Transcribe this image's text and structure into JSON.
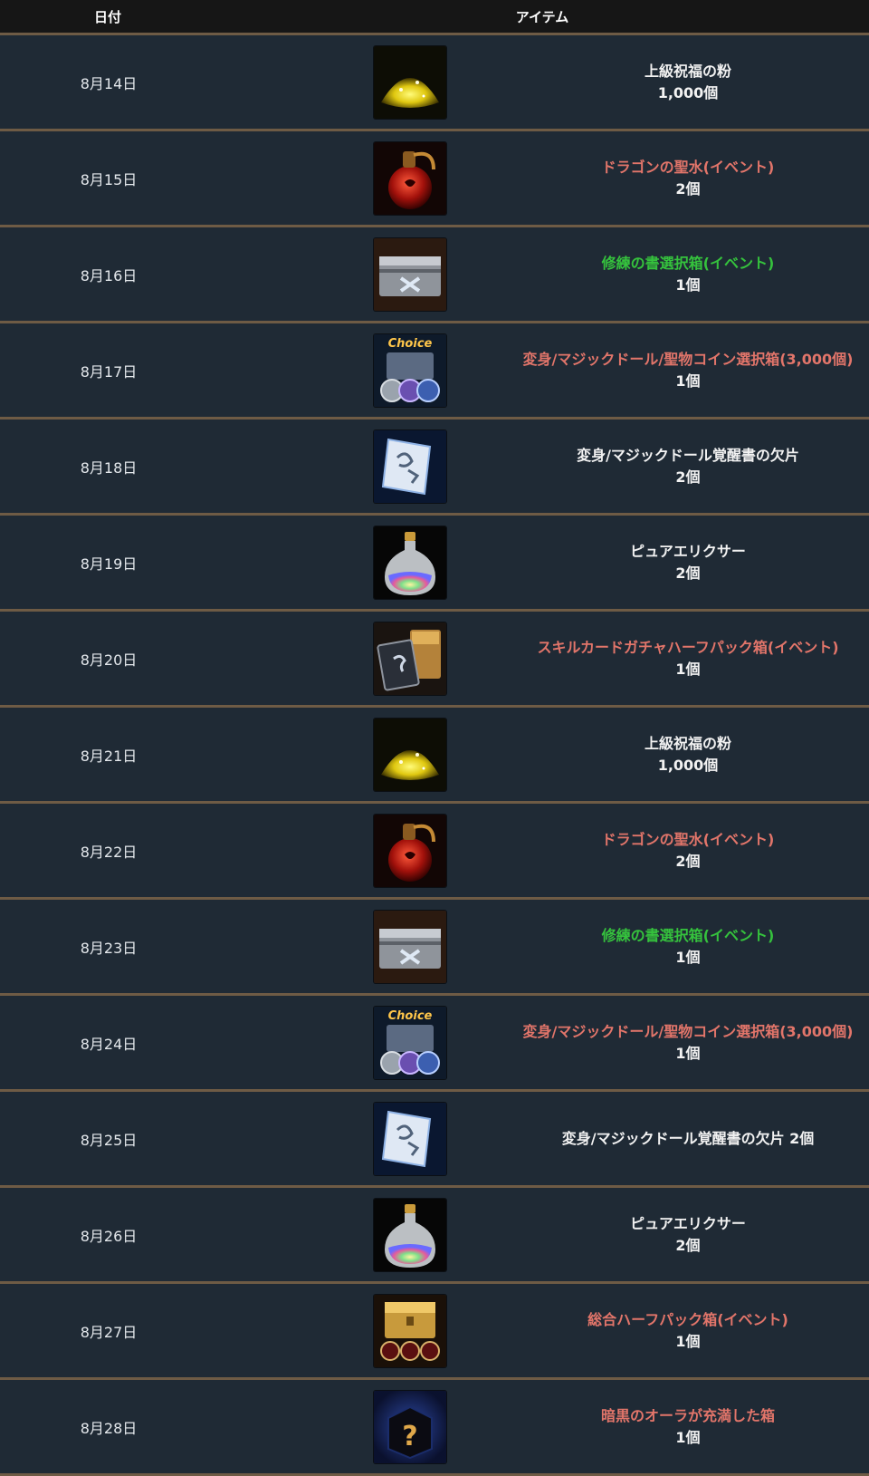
{
  "header": {
    "date_label": "日付",
    "item_label": "アイテム"
  },
  "colors": {
    "red": "#e2756a",
    "green": "#35c23d",
    "white": "#f2f2f2",
    "border": "#6e5b45",
    "bg": "#1f2a35"
  },
  "rows": [
    {
      "date": "8月14日",
      "icon": "gold-powder-icon",
      "name": "上級祝福の粉",
      "qty": "1,000個",
      "color": "white"
    },
    {
      "date": "8月15日",
      "icon": "dragon-holy-water-icon",
      "name": "ドラゴンの聖水(イベント)",
      "qty": "2個",
      "color": "red"
    },
    {
      "date": "8月16日",
      "icon": "training-book-box-icon",
      "name": "修練の書選択箱(イベント)",
      "qty": "1個",
      "color": "green"
    },
    {
      "date": "8月17日",
      "icon": "choice-coin-box-icon",
      "name": "変身/マジックドール/聖物コイン選択箱(3,000個)",
      "qty": "1個",
      "color": "red"
    },
    {
      "date": "8月18日",
      "icon": "awakening-scroll-fragment-icon",
      "name": "変身/マジックドール覚醒書の欠片",
      "qty": "2個",
      "color": "white"
    },
    {
      "date": "8月19日",
      "icon": "pure-elixir-icon",
      "name": "ピュアエリクサー",
      "qty": "2個",
      "color": "white"
    },
    {
      "date": "8月20日",
      "icon": "skill-card-box-icon",
      "name": "スキルカードガチャハーフパック箱(イベント)",
      "qty": "1個",
      "color": "red"
    },
    {
      "date": "8月21日",
      "icon": "gold-powder-icon",
      "name": "上級祝福の粉",
      "qty": "1,000個",
      "color": "white"
    },
    {
      "date": "8月22日",
      "icon": "dragon-holy-water-icon",
      "name": "ドラゴンの聖水(イベント)",
      "qty": "2個",
      "color": "red"
    },
    {
      "date": "8月23日",
      "icon": "training-book-box-icon",
      "name": "修練の書選択箱(イベント)",
      "qty": "1個",
      "color": "green"
    },
    {
      "date": "8月24日",
      "icon": "choice-coin-box-icon",
      "name": "変身/マジックドール/聖物コイン選択箱(3,000個)",
      "qty": "1個",
      "color": "red"
    },
    {
      "date": "8月25日",
      "icon": "awakening-scroll-fragment-icon",
      "name": "変身/マジックドール覚醒書の欠片 2個",
      "qty": "",
      "color": "white"
    },
    {
      "date": "8月26日",
      "icon": "pure-elixir-icon",
      "name": "ピュアエリクサー",
      "qty": "2個",
      "color": "white"
    },
    {
      "date": "8月27日",
      "icon": "half-pack-box-icon",
      "name": "総合ハーフパック箱(イベント)",
      "qty": "1個",
      "color": "red"
    },
    {
      "date": "8月28日",
      "icon": "dark-aura-box-icon",
      "name": "暗黒のオーラが充満した箱",
      "qty": "1個",
      "color": "red"
    }
  ],
  "choice_label": "Choice"
}
